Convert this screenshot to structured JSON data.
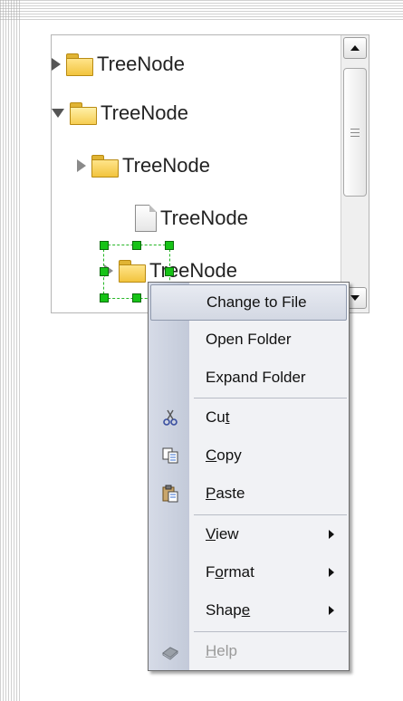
{
  "tree": {
    "nodes": [
      {
        "label": "TreeNode",
        "kind": "folder",
        "state": "collapsed"
      },
      {
        "label": "TreeNode",
        "kind": "folder",
        "state": "expanded"
      },
      {
        "label": "TreeNode",
        "kind": "folder",
        "state": "collapsed"
      },
      {
        "label": "TreeNode",
        "kind": "file",
        "state": "leaf"
      },
      {
        "label": "TreeNode",
        "kind": "folder",
        "state": "collapsed",
        "selected": true
      }
    ],
    "scrollbar_icons": [
      "scroll-up-arrow-icon",
      "scroll-thumb-grip-icon",
      "scroll-down-arrow-icon"
    ]
  },
  "context_menu": {
    "items": [
      {
        "label": "Change to File",
        "highlighted": true
      },
      {
        "label": "Open Folder"
      },
      {
        "label": "Expand Folder"
      },
      {
        "label": "Cut",
        "mnemonic": "t",
        "icon": "scissors-icon"
      },
      {
        "label": "Copy",
        "mnemonic": "C",
        "icon": "copy-icon"
      },
      {
        "label": "Paste",
        "mnemonic": "P",
        "icon": "paste-icon"
      },
      {
        "label": "View",
        "mnemonic": "V",
        "submenu": true
      },
      {
        "label": "Format",
        "mnemonic": "o",
        "submenu": true
      },
      {
        "label": "Shape",
        "mnemonic": "e",
        "submenu": true
      },
      {
        "label": "Help",
        "mnemonic": "H",
        "icon": "help-book-icon",
        "disabled": true
      }
    ]
  },
  "colors": {
    "menu_gutter": "#c8cfdd",
    "menu_background": "#f1f2f5",
    "selection_handles": "#16c316",
    "folder": "#f2c43e"
  }
}
